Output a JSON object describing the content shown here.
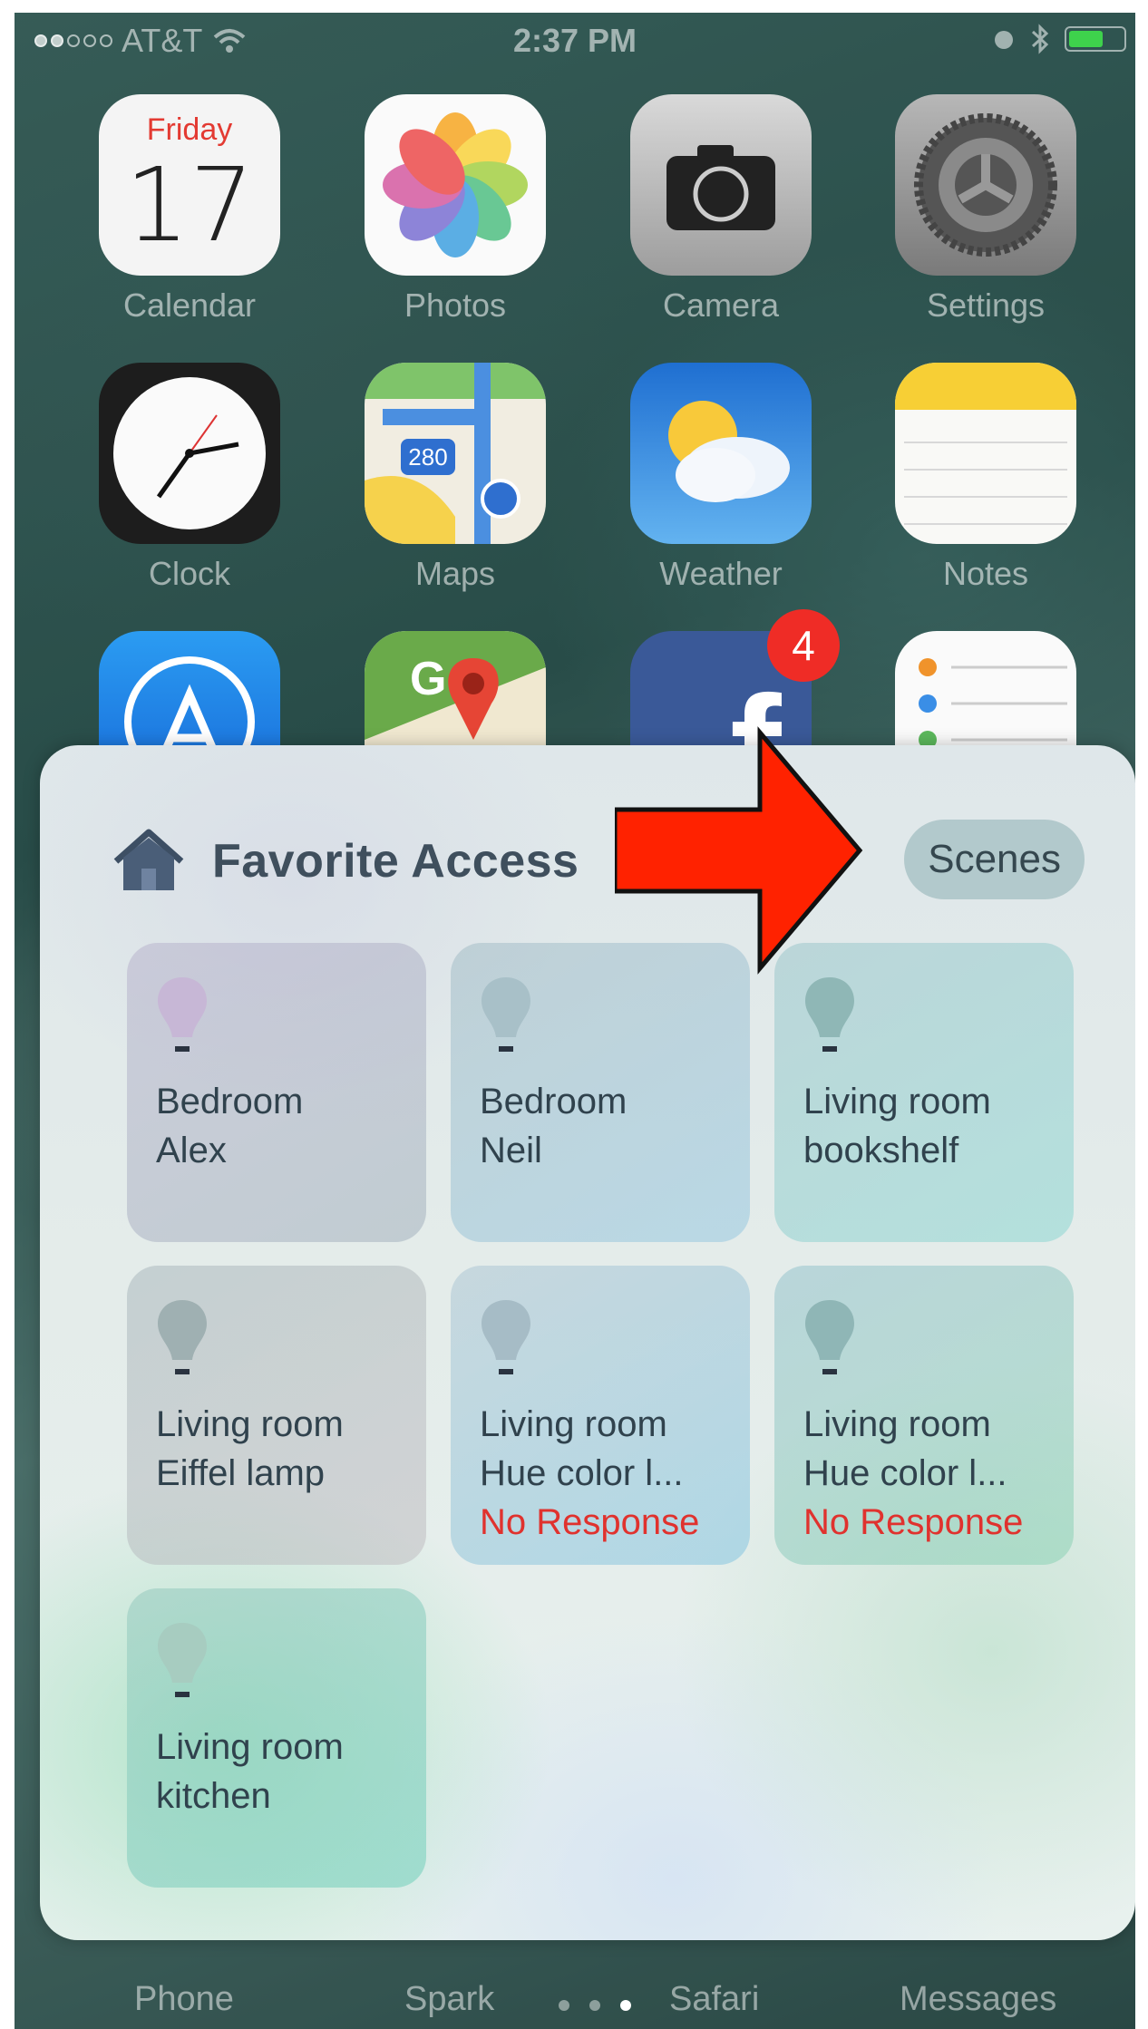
{
  "status_bar": {
    "carrier": "AT&T",
    "time": "2:37 PM"
  },
  "home_apps": [
    {
      "label": "Calendar",
      "icon": "calendar-icon",
      "day": "Friday",
      "date": "17"
    },
    {
      "label": "Photos",
      "icon": "photos-icon"
    },
    {
      "label": "Camera",
      "icon": "camera-icon"
    },
    {
      "label": "Settings",
      "icon": "gear-icon"
    },
    {
      "label": "Clock",
      "icon": "clock-icon"
    },
    {
      "label": "Maps",
      "icon": "maps-icon",
      "route": "280"
    },
    {
      "label": "Weather",
      "icon": "weather-icon"
    },
    {
      "label": "Notes",
      "icon": "notes-icon"
    }
  ],
  "partial_apps": {
    "gmaps_letter": "G",
    "facebook_letter": "f",
    "facebook_badge": "4"
  },
  "dock": [
    "Phone",
    "Spark",
    "Safari",
    "Messages"
  ],
  "widget": {
    "title": "Favorite Access",
    "title_icon": "home-icon",
    "scenes_label": "Scenes",
    "accessories": [
      {
        "line1": "Bedroom",
        "line2": "Alex",
        "status": ""
      },
      {
        "line1": "Bedroom",
        "line2": "Neil",
        "status": ""
      },
      {
        "line1": "Living room",
        "line2": "bookshelf",
        "status": ""
      },
      {
        "line1": "Living room",
        "line2": "Eiffel lamp",
        "status": ""
      },
      {
        "line1": "Living room",
        "line2": "Hue color l...",
        "status": "No Response"
      },
      {
        "line1": "Living room",
        "line2": "Hue color l...",
        "status": "No Response"
      },
      {
        "line1": "Living room",
        "line2": "kitchen",
        "status": ""
      }
    ]
  },
  "annotation": {
    "icon": "right-arrow-icon",
    "color": "#ff2200"
  }
}
